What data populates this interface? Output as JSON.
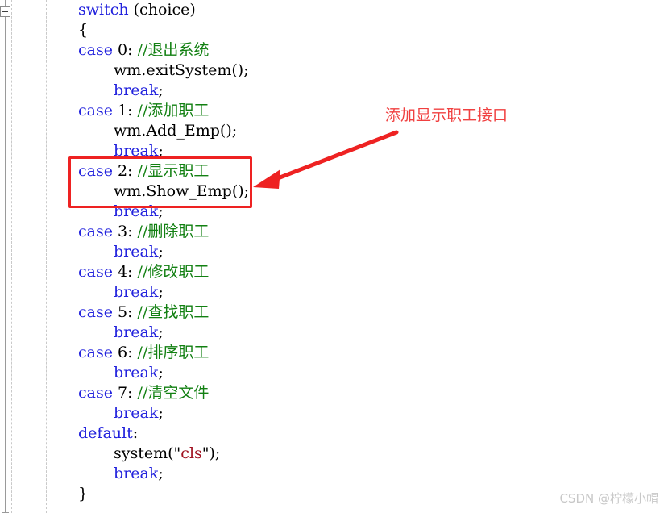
{
  "editor": {
    "gutter": {
      "fold_marker": "collapse-minus-box"
    },
    "lines": [
      {
        "indent": 0,
        "tokens": [
          {
            "t": "kw",
            "v": "switch"
          },
          {
            "t": "pl",
            "v": " (choice)"
          }
        ]
      },
      {
        "indent": 0,
        "tokens": [
          {
            "t": "pl",
            "v": "{"
          }
        ]
      },
      {
        "indent": 0,
        "tokens": [
          {
            "t": "kw",
            "v": "case"
          },
          {
            "t": "pl",
            "v": " 0: "
          },
          {
            "t": "cmt",
            "v": "//退出系统"
          }
        ]
      },
      {
        "indent": 1,
        "tokens": [
          {
            "t": "pl",
            "v": "wm.exitSystem();"
          }
        ]
      },
      {
        "indent": 1,
        "tokens": [
          {
            "t": "kw",
            "v": "break"
          },
          {
            "t": "pl",
            "v": ";"
          }
        ]
      },
      {
        "indent": 0,
        "tokens": [
          {
            "t": "kw",
            "v": "case"
          },
          {
            "t": "pl",
            "v": " 1: "
          },
          {
            "t": "cmt",
            "v": "//添加职工"
          }
        ]
      },
      {
        "indent": 1,
        "tokens": [
          {
            "t": "pl",
            "v": "wm.Add_Emp();"
          }
        ]
      },
      {
        "indent": 1,
        "tokens": [
          {
            "t": "kw",
            "v": "break"
          },
          {
            "t": "pl",
            "v": ";"
          }
        ]
      },
      {
        "indent": 0,
        "tokens": [
          {
            "t": "kw",
            "v": "case"
          },
          {
            "t": "pl",
            "v": " 2: "
          },
          {
            "t": "cmt",
            "v": "//显示职工"
          }
        ]
      },
      {
        "indent": 1,
        "tokens": [
          {
            "t": "pl",
            "v": "wm.Show_Emp();"
          }
        ]
      },
      {
        "indent": 1,
        "tokens": [
          {
            "t": "kw",
            "v": "break"
          },
          {
            "t": "pl",
            "v": ";"
          }
        ]
      },
      {
        "indent": 0,
        "tokens": [
          {
            "t": "kw",
            "v": "case"
          },
          {
            "t": "pl",
            "v": " 3: "
          },
          {
            "t": "cmt",
            "v": "//删除职工"
          }
        ]
      },
      {
        "indent": 1,
        "tokens": [
          {
            "t": "kw",
            "v": "break"
          },
          {
            "t": "pl",
            "v": ";"
          }
        ]
      },
      {
        "indent": 0,
        "tokens": [
          {
            "t": "kw",
            "v": "case"
          },
          {
            "t": "pl",
            "v": " 4: "
          },
          {
            "t": "cmt",
            "v": "//修改职工"
          }
        ]
      },
      {
        "indent": 1,
        "tokens": [
          {
            "t": "kw",
            "v": "break"
          },
          {
            "t": "pl",
            "v": ";"
          }
        ]
      },
      {
        "indent": 0,
        "tokens": [
          {
            "t": "kw",
            "v": "case"
          },
          {
            "t": "pl",
            "v": " 5: "
          },
          {
            "t": "cmt",
            "v": "//查找职工"
          }
        ]
      },
      {
        "indent": 1,
        "tokens": [
          {
            "t": "kw",
            "v": "break"
          },
          {
            "t": "pl",
            "v": ";"
          }
        ]
      },
      {
        "indent": 0,
        "tokens": [
          {
            "t": "kw",
            "v": "case"
          },
          {
            "t": "pl",
            "v": " 6: "
          },
          {
            "t": "cmt",
            "v": "//排序职工"
          }
        ]
      },
      {
        "indent": 1,
        "tokens": [
          {
            "t": "kw",
            "v": "break"
          },
          {
            "t": "pl",
            "v": ";"
          }
        ]
      },
      {
        "indent": 0,
        "tokens": [
          {
            "t": "kw",
            "v": "case"
          },
          {
            "t": "pl",
            "v": " 7: "
          },
          {
            "t": "cmt",
            "v": "//清空文件"
          }
        ]
      },
      {
        "indent": 1,
        "tokens": [
          {
            "t": "kw",
            "v": "break"
          },
          {
            "t": "pl",
            "v": ";"
          }
        ]
      },
      {
        "indent": 0,
        "tokens": [
          {
            "t": "kw",
            "v": "default"
          },
          {
            "t": "pl",
            "v": ":"
          }
        ]
      },
      {
        "indent": 1,
        "tokens": [
          {
            "t": "pl",
            "v": "system(\""
          },
          {
            "t": "str",
            "v": "cls"
          },
          {
            "t": "pl",
            "v": "\");"
          }
        ]
      },
      {
        "indent": 1,
        "tokens": [
          {
            "t": "kw",
            "v": "break"
          },
          {
            "t": "pl",
            "v": ";"
          }
        ]
      },
      {
        "indent": 0,
        "tokens": [
          {
            "t": "pl",
            "v": "}"
          }
        ]
      }
    ],
    "colors": {
      "keyword": "#2222dd",
      "comment": "#128012",
      "string": "#a01020",
      "plain": "#000000",
      "background": "#ffffff",
      "indent_guide": "#c9c9c9"
    }
  },
  "annotation": {
    "label": "添加显示职工接口",
    "color": "#f04040",
    "box_color": "#ee2222",
    "arrow_name": "red-arrow-pointing-left"
  },
  "watermark": {
    "text": "CSDN @柠檬小帽"
  }
}
